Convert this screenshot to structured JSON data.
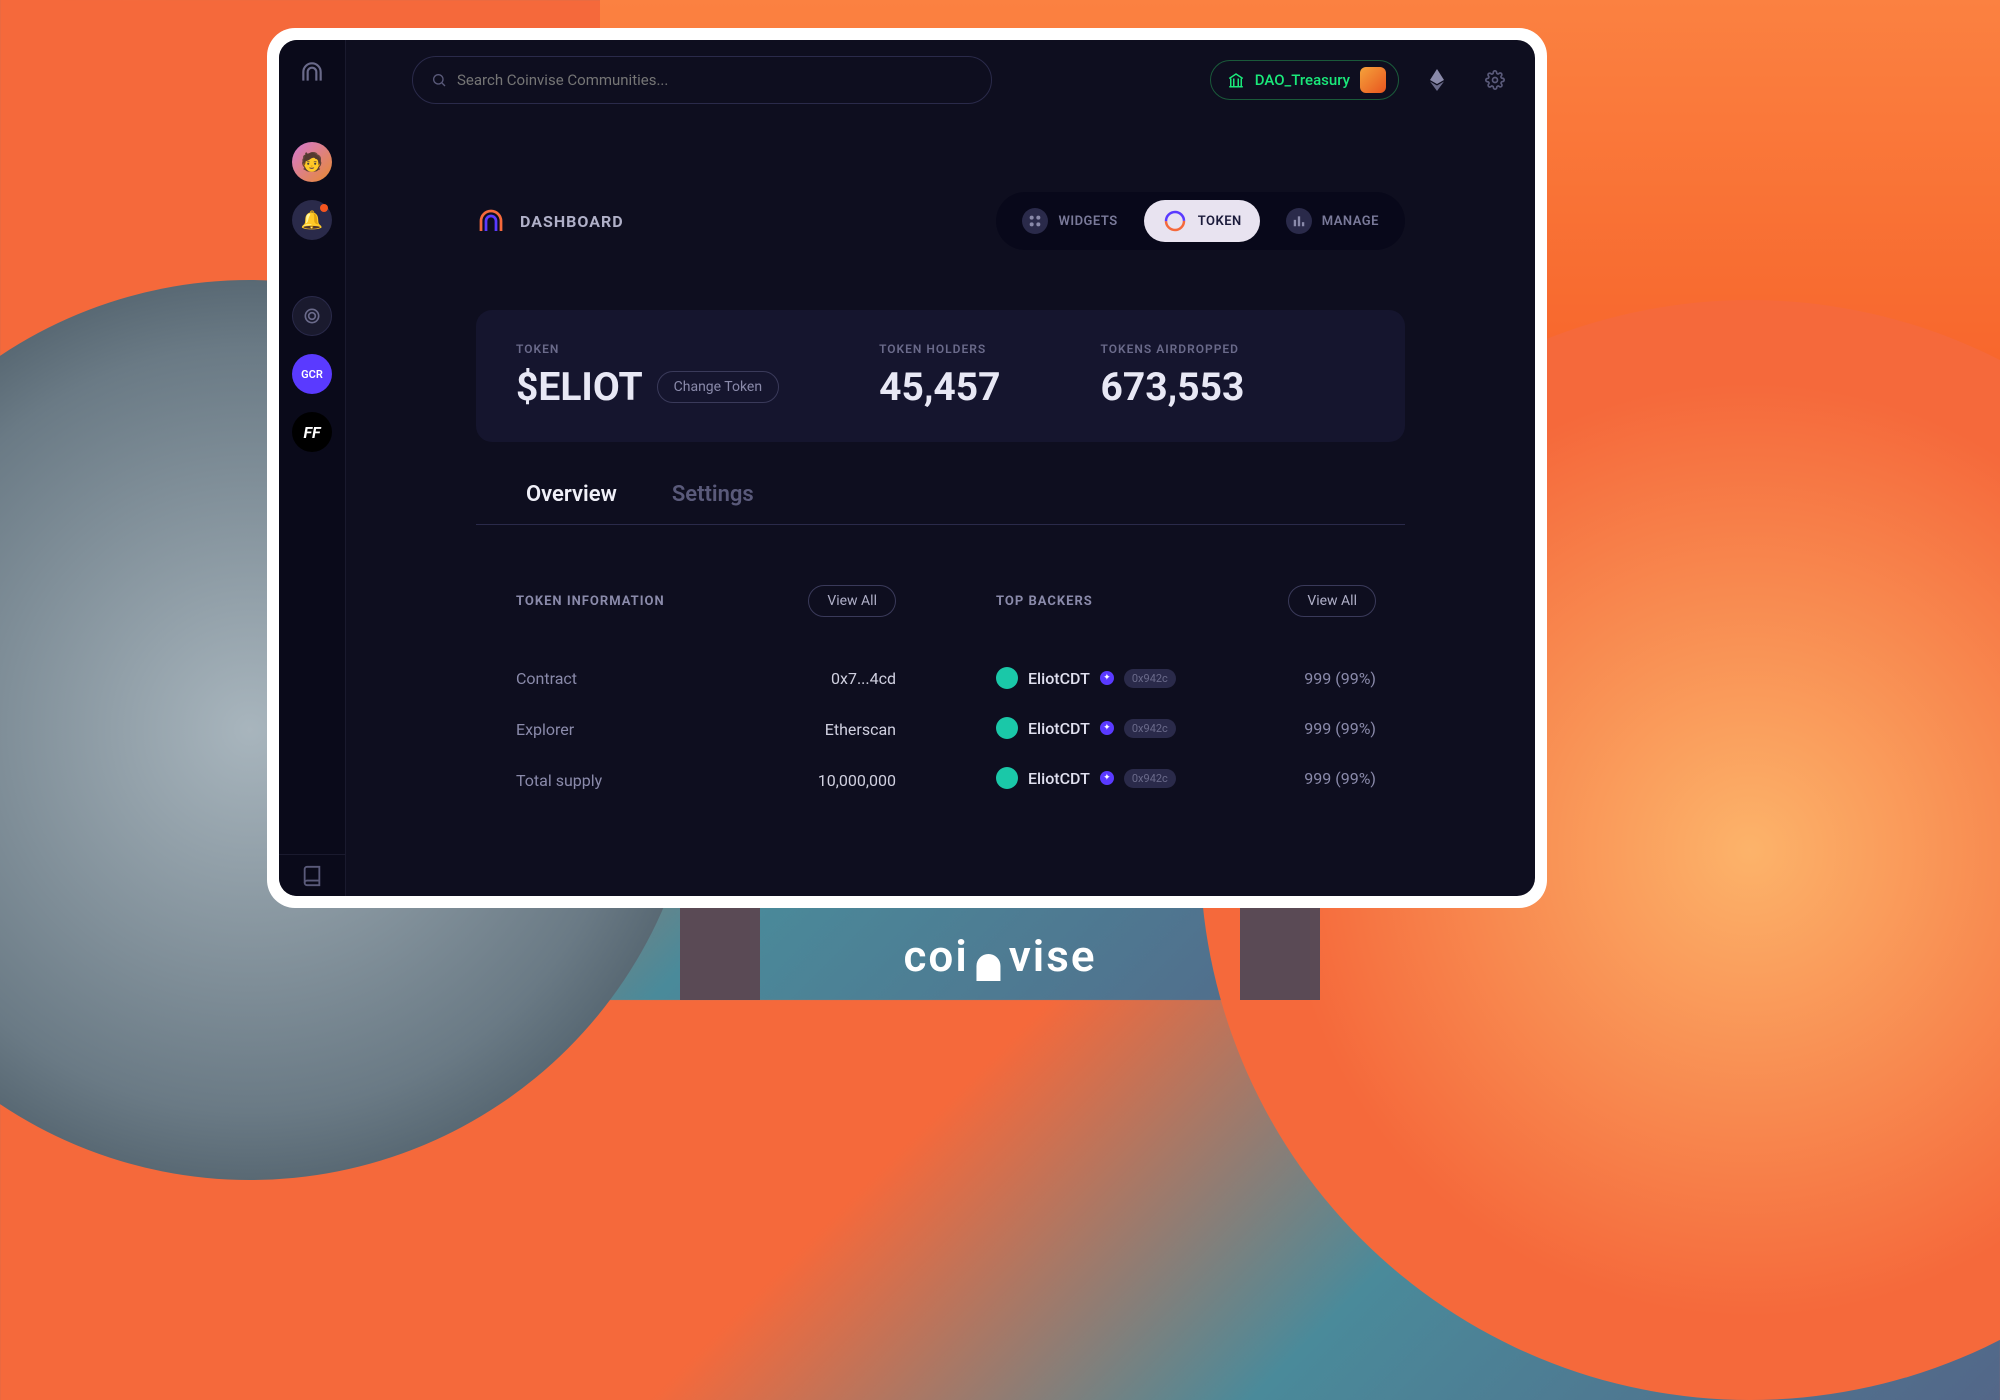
{
  "search": {
    "placeholder": "Search Coinvise Communities..."
  },
  "wallet": {
    "label": "DAO_Treasury"
  },
  "sidebar": {
    "gcr": "GCR",
    "ff": "FF"
  },
  "dashboard": {
    "title": "DASHBOARD",
    "tabs": {
      "widgets": "WIDGETS",
      "token": "TOKEN",
      "manage": "MANAGE"
    }
  },
  "stats": {
    "token_label": "TOKEN",
    "token_value": "$ELIOT",
    "change_btn": "Change Token",
    "holders_label": "TOKEN HOLDERS",
    "holders_value": "45,457",
    "airdropped_label": "TOKENS AIRDROPPED",
    "airdropped_value": "673,553"
  },
  "subtabs": {
    "overview": "Overview",
    "settings": "Settings"
  },
  "token_info": {
    "title": "TOKEN INFORMATION",
    "view_all": "View All",
    "rows": [
      {
        "label": "Contract",
        "value": "0x7...4cd"
      },
      {
        "label": "Explorer",
        "value": "Etherscan"
      },
      {
        "label": "Total supply",
        "value": "10,000,000"
      }
    ]
  },
  "backers": {
    "title": "TOP BACKERS",
    "view_all": "View All",
    "rows": [
      {
        "name": "EliotCDT",
        "addr": "0x942c",
        "val": "999 (99%)"
      },
      {
        "name": "EliotCDT",
        "addr": "0x942c",
        "val": "999 (99%)"
      },
      {
        "name": "EliotCDT",
        "addr": "0x942c",
        "val": "999 (99%)"
      }
    ]
  },
  "brand": "coinvise"
}
